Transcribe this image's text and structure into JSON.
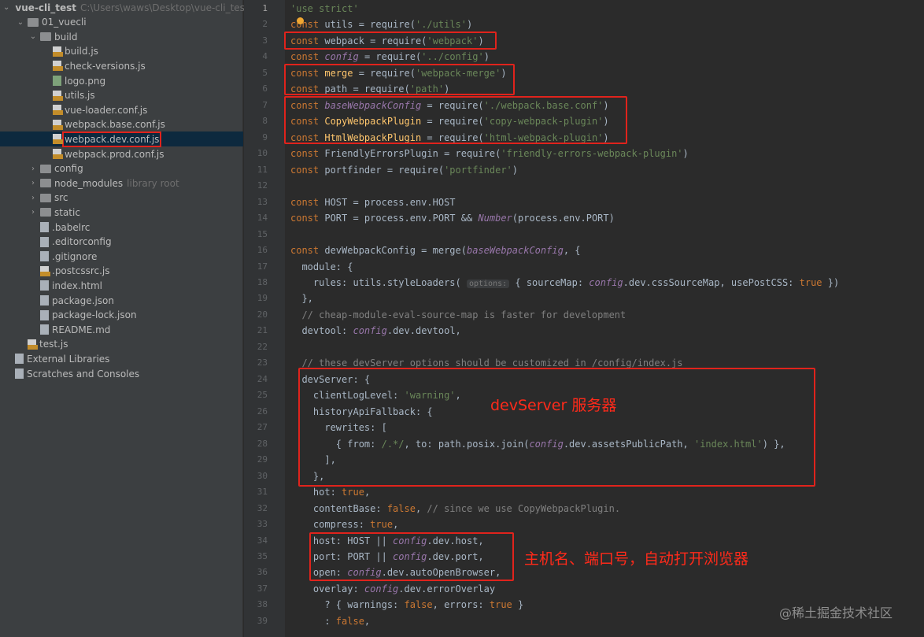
{
  "sidebar": {
    "items": [
      {
        "label": "vue-cli_test",
        "hint": "C:\\Users\\waws\\Desktop\\vue-cli_test",
        "icon": "folder",
        "depth": 0,
        "arrow": "v",
        "bold": true
      },
      {
        "label": "01_vuecli",
        "icon": "folder",
        "depth": 1,
        "arrow": "v"
      },
      {
        "label": "build",
        "icon": "folder",
        "depth": 2,
        "arrow": "v"
      },
      {
        "label": "build.js",
        "icon": "js",
        "depth": 3
      },
      {
        "label": "check-versions.js",
        "icon": "js",
        "depth": 3
      },
      {
        "label": "logo.png",
        "icon": "png",
        "depth": 3
      },
      {
        "label": "utils.js",
        "icon": "js",
        "depth": 3
      },
      {
        "label": "vue-loader.conf.js",
        "icon": "js",
        "depth": 3
      },
      {
        "label": "webpack.base.conf.js",
        "icon": "js",
        "depth": 3
      },
      {
        "label": "webpack.dev.conf.js",
        "icon": "js",
        "depth": 3,
        "selected": true
      },
      {
        "label": "webpack.prod.conf.js",
        "icon": "js",
        "depth": 3
      },
      {
        "label": "config",
        "icon": "folder",
        "depth": 2,
        "arrow": ">"
      },
      {
        "label": "node_modules",
        "hint": "library root",
        "icon": "folder",
        "depth": 2,
        "arrow": ">"
      },
      {
        "label": "src",
        "icon": "folder",
        "depth": 2,
        "arrow": ">"
      },
      {
        "label": "static",
        "icon": "folder",
        "depth": 2,
        "arrow": ">"
      },
      {
        "label": ".babelrc",
        "icon": "file",
        "depth": 2
      },
      {
        "label": ".editorconfig",
        "icon": "file",
        "depth": 2
      },
      {
        "label": ".gitignore",
        "icon": "file",
        "depth": 2
      },
      {
        "label": ".postcssrc.js",
        "icon": "js",
        "depth": 2
      },
      {
        "label": "index.html",
        "icon": "file",
        "depth": 2
      },
      {
        "label": "package.json",
        "icon": "file",
        "depth": 2
      },
      {
        "label": "package-lock.json",
        "icon": "file",
        "depth": 2
      },
      {
        "label": "README.md",
        "icon": "file",
        "depth": 2
      },
      {
        "label": "test.js",
        "icon": "js",
        "depth": 1
      },
      {
        "label": "External Libraries",
        "icon": "file",
        "depth": 0
      },
      {
        "label": "Scratches and Consoles",
        "icon": "file",
        "depth": 0
      }
    ]
  },
  "code": [
    [
      [
        "s",
        "'use strict'"
      ]
    ],
    [
      [
        "k",
        "const "
      ],
      [
        "",
        "utils = "
      ],
      [
        "",
        "require"
      ],
      [
        "",
        "("
      ],
      [
        "s",
        "'./utils'"
      ],
      [
        "",
        ")"
      ]
    ],
    [
      [
        "k",
        "const "
      ],
      [
        "",
        "webpack = require("
      ],
      [
        "s",
        "'webpack'"
      ],
      [
        "",
        ")"
      ]
    ],
    [
      [
        "k",
        "const "
      ],
      [
        "p",
        "config"
      ],
      [
        "",
        " = require("
      ],
      [
        "s",
        "'../config'"
      ],
      [
        "",
        ")"
      ]
    ],
    [
      [
        "k",
        "const "
      ],
      [
        "f",
        "merge"
      ],
      [
        "",
        " = require("
      ],
      [
        "s",
        "'webpack-merge'"
      ],
      [
        "",
        ")"
      ]
    ],
    [
      [
        "k",
        "const "
      ],
      [
        "",
        "path = require("
      ],
      [
        "s",
        "'path'"
      ],
      [
        "",
        ")"
      ]
    ],
    [
      [
        "k",
        "const "
      ],
      [
        "p",
        "baseWebpackConfig"
      ],
      [
        "",
        " = require("
      ],
      [
        "s",
        "'./webpack.base.conf'"
      ],
      [
        "",
        ")"
      ]
    ],
    [
      [
        "k",
        "const "
      ],
      [
        "f",
        "CopyWebpackPlugin"
      ],
      [
        "",
        " = require("
      ],
      [
        "s",
        "'copy-webpack-plugin'"
      ],
      [
        "",
        ")"
      ]
    ],
    [
      [
        "k",
        "const "
      ],
      [
        "f",
        "HtmlWebpackPlugin"
      ],
      [
        "",
        " = require("
      ],
      [
        "s",
        "'html-webpack-plugin'"
      ],
      [
        "",
        ")"
      ]
    ],
    [
      [
        "k",
        "const "
      ],
      [
        "",
        "FriendlyErrorsPlugin = require("
      ],
      [
        "s",
        "'friendly-errors-webpack-plugin'"
      ],
      [
        "",
        ")"
      ]
    ],
    [
      [
        "k",
        "const "
      ],
      [
        "",
        "portfinder = require("
      ],
      [
        "s",
        "'portfinder'"
      ],
      [
        "",
        ")"
      ]
    ],
    [],
    [
      [
        "k",
        "const "
      ],
      [
        "",
        "HOST = process.env.HOST"
      ]
    ],
    [
      [
        "k",
        "const "
      ],
      [
        "",
        "PORT = process.env.PORT && "
      ],
      [
        "p",
        "Number"
      ],
      [
        "",
        "(process.env.PORT)"
      ]
    ],
    [],
    [
      [
        "k",
        "const "
      ],
      [
        "",
        "devWebpackConfig = merge("
      ],
      [
        "p",
        "baseWebpackConfig"
      ],
      [
        "",
        ", {"
      ]
    ],
    [
      [
        "",
        "  module: {"
      ]
    ],
    [
      [
        "",
        "    rules: utils.styleLoaders( "
      ],
      [
        "h",
        "options:"
      ],
      [
        "",
        " { sourceMap: "
      ],
      [
        "p",
        "config"
      ],
      [
        "",
        ".dev.cssSourceMap, usePostCSS: "
      ],
      [
        "k",
        "true"
      ],
      [
        "",
        " })"
      ]
    ],
    [
      [
        "",
        "  },"
      ]
    ],
    [
      [
        "c",
        "  // cheap-module-eval-source-map is faster for development"
      ]
    ],
    [
      [
        "",
        "  devtool: "
      ],
      [
        "p",
        "config"
      ],
      [
        "",
        ".dev.devtool,"
      ]
    ],
    [],
    [
      [
        "c",
        "  // these devServer options should be customized in /config/index.js"
      ]
    ],
    [
      [
        "",
        "  devServer: {"
      ]
    ],
    [
      [
        "",
        "    clientLogLevel: "
      ],
      [
        "s",
        "'warning'"
      ],
      [
        "",
        ","
      ]
    ],
    [
      [
        "",
        "    historyApiFallback: {"
      ]
    ],
    [
      [
        "",
        "      rewrites: ["
      ]
    ],
    [
      [
        "",
        "        { from: "
      ],
      [
        "s",
        "/.*/"
      ],
      [
        "",
        ", to: path.posix.join("
      ],
      [
        "p",
        "config"
      ],
      [
        "",
        ".dev.assetsPublicPath, "
      ],
      [
        "s",
        "'index.html'"
      ],
      [
        "",
        ") },"
      ]
    ],
    [
      [
        "",
        "      ],"
      ]
    ],
    [
      [
        "",
        "    },"
      ]
    ],
    [
      [
        "",
        "    hot: "
      ],
      [
        "k",
        "true"
      ],
      [
        "",
        ","
      ]
    ],
    [
      [
        "",
        "    contentBase: "
      ],
      [
        "k",
        "false"
      ],
      [
        "",
        ", "
      ],
      [
        "c",
        "// since we use CopyWebpackPlugin."
      ]
    ],
    [
      [
        "",
        "    compress: "
      ],
      [
        "k",
        "true"
      ],
      [
        "",
        ","
      ]
    ],
    [
      [
        "",
        "    host: HOST || "
      ],
      [
        "p",
        "config"
      ],
      [
        "",
        ".dev.host,"
      ]
    ],
    [
      [
        "",
        "    port: PORT || "
      ],
      [
        "p",
        "config"
      ],
      [
        "",
        ".dev.port,"
      ]
    ],
    [
      [
        "",
        "    open: "
      ],
      [
        "p",
        "config"
      ],
      [
        "",
        ".dev.autoOpenBrowser,"
      ]
    ],
    [
      [
        "",
        "    overlay: "
      ],
      [
        "p",
        "config"
      ],
      [
        "",
        ".dev.errorOverlay"
      ]
    ],
    [
      [
        "",
        "      ? { warnings: "
      ],
      [
        "k",
        "false"
      ],
      [
        "",
        ", errors: "
      ],
      [
        "k",
        "true"
      ],
      [
        "",
        " }"
      ]
    ],
    [
      [
        "",
        "      : "
      ],
      [
        "k",
        "false"
      ],
      [
        "",
        ","
      ]
    ]
  ],
  "annotations": {
    "dev_server": "devServer 服务器",
    "host_port": "主机名、端口号，自动打开浏览器"
  },
  "watermark": "@稀土掘金技术社区"
}
